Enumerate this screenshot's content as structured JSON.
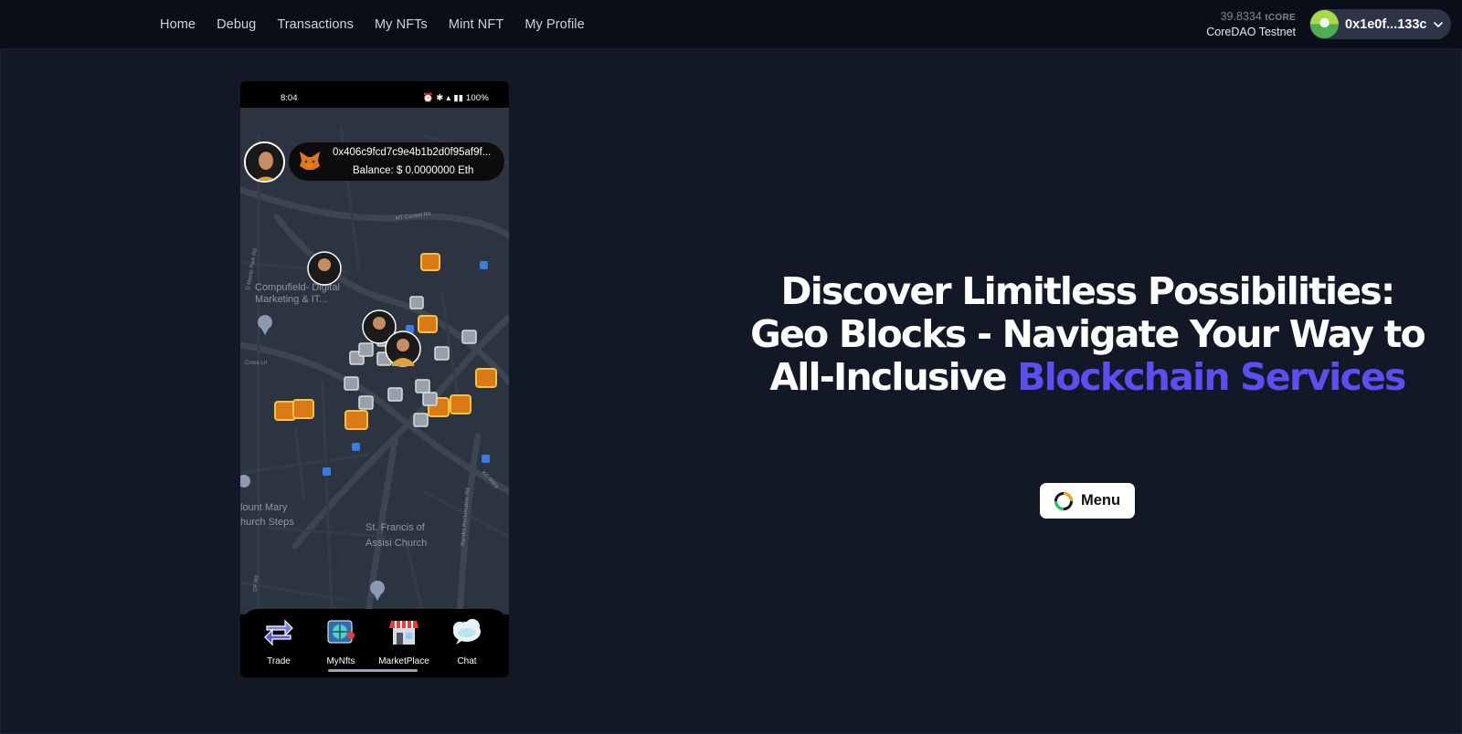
{
  "nav": {
    "items": [
      "Home",
      "Debug",
      "Transactions",
      "My NFTs",
      "Mint NFT",
      "My Profile"
    ]
  },
  "wallet_header": {
    "balance_amount": "39.8334",
    "balance_unit": "tCORE",
    "network": "CoreDAO Testnet",
    "address": "0x1e0f...133c"
  },
  "phone": {
    "status_time": "8:04",
    "status_battery": "100%",
    "wallet_address": "0x406c9fcd7c9e4b1b2d0f95af9f...",
    "wallet_balance": "Balance: $ 0.0000000 Eth",
    "map_labels": {
      "place1": "Compufield- Digital Marketing & IT...",
      "place2": "lount Mary hurch Steps",
      "place3": "St. Francis of Assisi Church",
      "road1": "MT Carmel Rd",
      "road2": "Cross Ln",
      "road3": "D Monte Park Rd",
      "road4": "Bandra Reclamation Rd",
      "road5": "KC Marg",
      "road6": "DP Rd"
    },
    "tabs": [
      "Trade",
      "MyNfts",
      "MarketPlace",
      "Chat"
    ]
  },
  "hero": {
    "line1": "Discover Limitless Possibilities:",
    "line2": "Geo Blocks - Navigate Your Way to",
    "line3_plain": "All-Inclusive ",
    "line3_accent": "Blockchain Services",
    "accent_color": "#5a4ff0"
  },
  "menu_button": {
    "label": "Menu"
  }
}
